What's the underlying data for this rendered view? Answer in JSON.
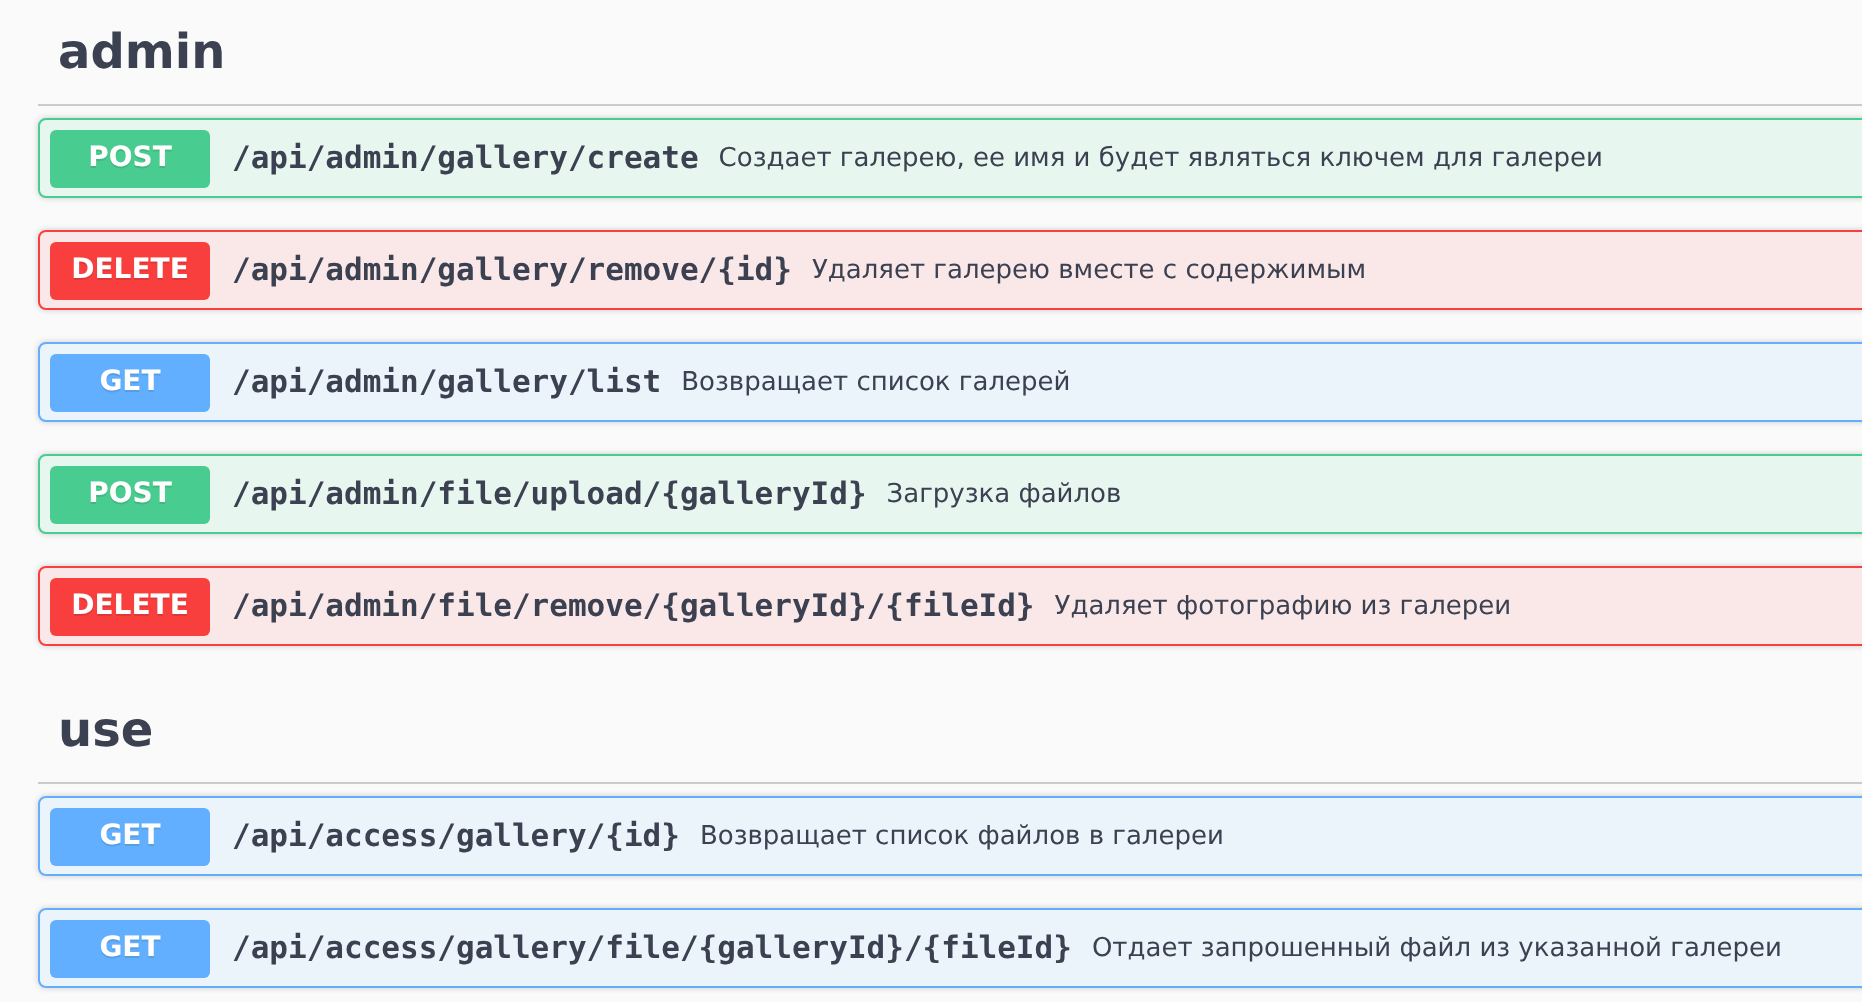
{
  "sections": [
    {
      "title": "admin",
      "operations": [
        {
          "method": "POST",
          "path": "/api/admin/gallery/create",
          "summary": "Создает галерею, ее имя и будет являться ключем для галереи"
        },
        {
          "method": "DELETE",
          "path": "/api/admin/gallery/remove/{id}",
          "summary": "Удаляет галерею вместе с содержимым"
        },
        {
          "method": "GET",
          "path": "/api/admin/gallery/list",
          "summary": "Возвращает список галерей"
        },
        {
          "method": "POST",
          "path": "/api/admin/file/upload/{galleryId}",
          "summary": "Загрузка файлов"
        },
        {
          "method": "DELETE",
          "path": "/api/admin/file/remove/{galleryId}/{fileId}",
          "summary": "Удаляет фотографию из галереи"
        }
      ]
    },
    {
      "title": "use",
      "operations": [
        {
          "method": "GET",
          "path": "/api/access/gallery/{id}",
          "summary": "Возвращает список файлов в галереи"
        },
        {
          "method": "GET",
          "path": "/api/access/gallery/file/{galleryId}/{fileId}",
          "summary": "Отдает запрошенный файл из указанной галереи"
        }
      ]
    }
  ]
}
